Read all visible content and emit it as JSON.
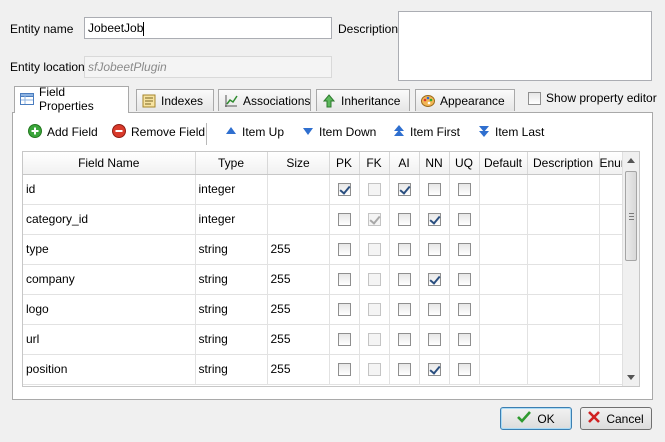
{
  "form": {
    "entity_name_label": "Entity name",
    "entity_name_value": "JobeetJob",
    "description_label": "Description",
    "description_value": "",
    "entity_location_label": "Entity location",
    "entity_location_value": "sfJobeetPlugin"
  },
  "tabs": [
    {
      "label": "Field Properties",
      "icon": "table-icon",
      "active": true
    },
    {
      "label": "Indexes",
      "icon": "indexes-icon",
      "active": false
    },
    {
      "label": "Associations",
      "icon": "associations-icon",
      "active": false
    },
    {
      "label": "Inheritance",
      "icon": "inheritance-arrow-icon",
      "active": false
    },
    {
      "label": "Appearance",
      "icon": "palette-icon",
      "active": false
    }
  ],
  "show_property_editor": {
    "label": "Show property editor",
    "checked": false
  },
  "toolbar": {
    "add_field": "Add Field",
    "remove_field": "Remove Field",
    "item_up": "Item Up",
    "item_down": "Item Down",
    "item_first": "Item First",
    "item_last": "Item Last"
  },
  "grid": {
    "columns": [
      "Field Name",
      "Type",
      "Size",
      "PK",
      "FK",
      "AI",
      "NN",
      "UQ",
      "Default",
      "Description",
      "Enum"
    ],
    "rows": [
      {
        "name": "id",
        "type": "integer",
        "size": "",
        "pk": true,
        "fk": false,
        "ai": true,
        "nn": false,
        "uq": false
      },
      {
        "name": "category_id",
        "type": "integer",
        "size": "",
        "pk": false,
        "fk": true,
        "ai": false,
        "nn": true,
        "uq": false
      },
      {
        "name": "type",
        "type": "string",
        "size": "255",
        "pk": false,
        "fk": false,
        "ai": false,
        "nn": false,
        "uq": false
      },
      {
        "name": "company",
        "type": "string",
        "size": "255",
        "pk": false,
        "fk": false,
        "ai": false,
        "nn": true,
        "uq": false
      },
      {
        "name": "logo",
        "type": "string",
        "size": "255",
        "pk": false,
        "fk": false,
        "ai": false,
        "nn": false,
        "uq": false
      },
      {
        "name": "url",
        "type": "string",
        "size": "255",
        "pk": false,
        "fk": false,
        "ai": false,
        "nn": false,
        "uq": false
      },
      {
        "name": "position",
        "type": "string",
        "size": "255",
        "pk": false,
        "fk": false,
        "ai": false,
        "nn": true,
        "uq": false
      }
    ]
  },
  "buttons": {
    "ok": "OK",
    "cancel": "Cancel"
  },
  "colors": {
    "ok_check": "#2f9a2f",
    "cancel_x": "#d02020",
    "add_green": "#3aa53a",
    "remove_red": "#d93a2b",
    "arrow_blue": "#2f6fcf"
  }
}
